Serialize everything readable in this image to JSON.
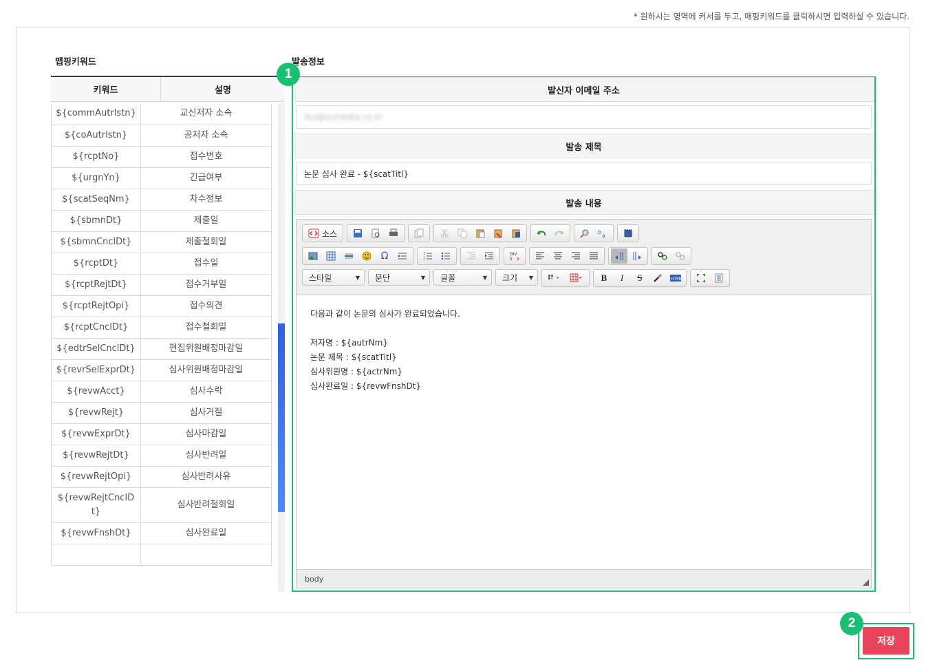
{
  "top_note": "* 원하시는 영역에 커서를 두고, 매핑키워드를 클릭하시면 입력하실 수 있습니다.",
  "mapping": {
    "title": "맵핑키워드",
    "col_keyword": "키워드",
    "col_desc": "설명",
    "rows": [
      {
        "k": "${commAutrlstn}",
        "d": "교신저자 소속"
      },
      {
        "k": "${coAutrlstn}",
        "d": "공저자 소속"
      },
      {
        "k": "${rcptNo}",
        "d": "접수번호"
      },
      {
        "k": "${urgnYn}",
        "d": "긴급여부"
      },
      {
        "k": "${scatSeqNm}",
        "d": "차수정보"
      },
      {
        "k": "${sbmnDt}",
        "d": "제출일"
      },
      {
        "k": "${sbmnCnclDt}",
        "d": "제출철회일"
      },
      {
        "k": "${rcptDt}",
        "d": "접수일"
      },
      {
        "k": "${rcptRejtDt}",
        "d": "접수거부일"
      },
      {
        "k": "${rcptRejtOpi}",
        "d": "접수의견"
      },
      {
        "k": "${rcptCnclDt}",
        "d": "접수철회일"
      },
      {
        "k": "${edtrSelCnclDt}",
        "d": "편집위원배정마감일"
      },
      {
        "k": "${revrSelExprDt}",
        "d": "심사위원배정마감일"
      },
      {
        "k": "${revwAcct}",
        "d": "심사수락"
      },
      {
        "k": "${revwRejt}",
        "d": "심사거절"
      },
      {
        "k": "${revwExprDt}",
        "d": "심사마감일"
      },
      {
        "k": "${revwRejtDt}",
        "d": "심사반려일"
      },
      {
        "k": "${revwRejtOpi}",
        "d": "심사반려사유"
      },
      {
        "k": "${revwRejtCnclDt}",
        "d": "심사반려철회일"
      },
      {
        "k": "${revwFnshDt}",
        "d": "심사완료일"
      },
      {
        "k": "",
        "d": ""
      }
    ]
  },
  "send": {
    "title": "발송정보",
    "sender_label": "발신자 이메일 주소",
    "sender_value": "tks@sumedia.co.kr",
    "subject_label": "발송 제목",
    "subject_value": "논문 심사 완료 - ${scatTitl}",
    "content_label": "발송 내용"
  },
  "editor": {
    "source_label": "소스",
    "style_label": "스타일",
    "format_label": "문단",
    "font_label": "글꼴",
    "size_label": "크기",
    "status_path": "body",
    "body_lines": [
      "다음과 같이 논문의 심사가 완료되었습니다.",
      "",
      "저자명 : ${autrNm}",
      "논문 제목 : ${scatTitl}",
      "심사위원명 : ${actrNm}",
      "심사완료일 : ${revwFnshDt}"
    ]
  },
  "badges": {
    "one": "1",
    "two": "2"
  },
  "save_label": "저장",
  "colors": {
    "accent_green": "#1bbf74",
    "save_red": "#e8445a",
    "scroll_blue": "#3a72e8"
  }
}
